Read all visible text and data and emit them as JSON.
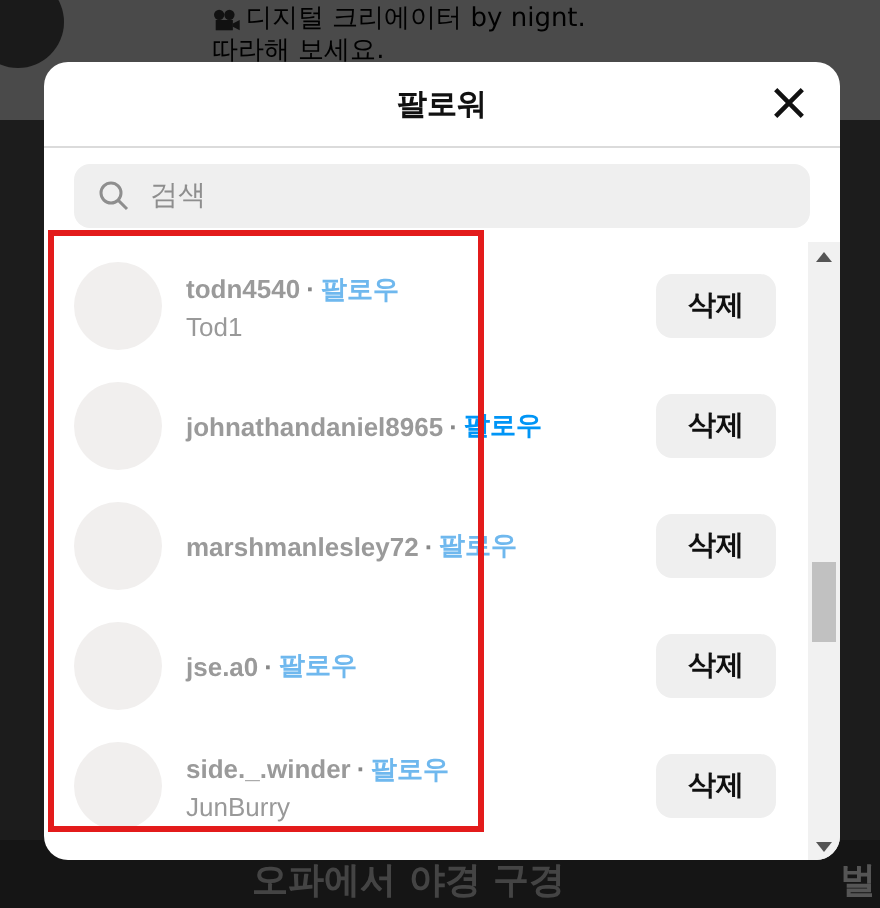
{
  "background": {
    "bio_lines": [
      "디지털 크리에이터 by nignt.",
      "따라해 보세요."
    ],
    "caption": "오파에서 야경 구경",
    "corner_text": "벌"
  },
  "modal": {
    "title": "팔로워",
    "search": {
      "placeholder": "검색"
    },
    "rows": [
      {
        "username": "todn4540",
        "separator": "·",
        "follow": "팔로우",
        "name": "Tod1",
        "follow_dimmed": true,
        "remove": "삭제"
      },
      {
        "username": "johnathandaniel8965",
        "separator": "·",
        "follow": "팔로우",
        "follow_dimmed": false,
        "remove": "삭제"
      },
      {
        "username": "marshmanlesley72",
        "separator": "·",
        "follow": "팔로우",
        "follow_dimmed": true,
        "remove": "삭제"
      },
      {
        "username": "jse.a0",
        "separator": "·",
        "follow": "팔로우",
        "follow_dimmed": true,
        "remove": "삭제"
      },
      {
        "username": "side._.winder",
        "separator": "·",
        "follow": "팔로우",
        "name": "JunBurry",
        "follow_dimmed": true,
        "remove": "삭제"
      }
    ]
  }
}
